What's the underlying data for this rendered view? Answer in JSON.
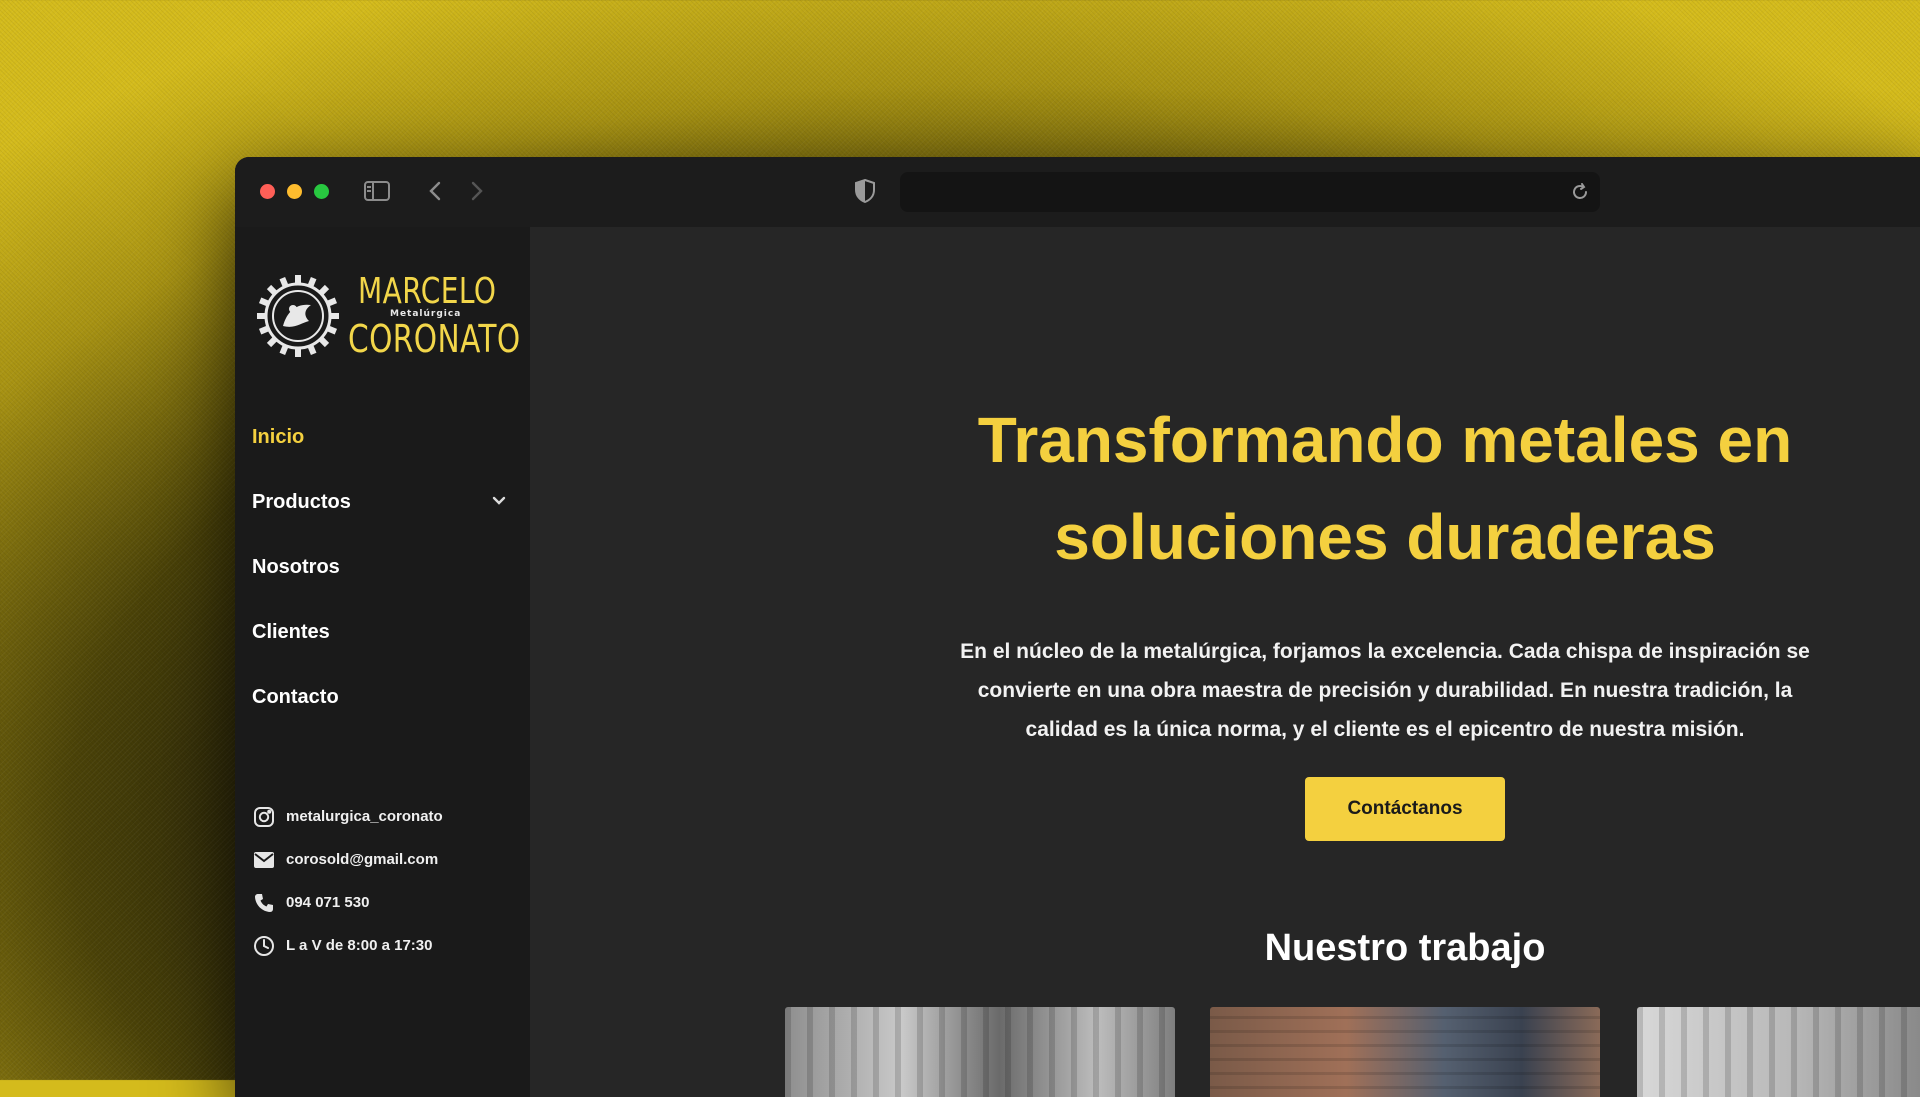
{
  "brand": {
    "name_line1": "MARCELO",
    "name_sub": "Metalúrgica",
    "name_line2": "CORONATO",
    "accent_color": "#f4d03f"
  },
  "nav": {
    "items": [
      {
        "label": "Inicio",
        "active": true
      },
      {
        "label": "Productos",
        "has_dropdown": true
      },
      {
        "label": "Nosotros"
      },
      {
        "label": "Clientes"
      },
      {
        "label": "Contacto"
      }
    ]
  },
  "contacts": [
    {
      "icon": "instagram-icon",
      "text": "metalurgica_coronato"
    },
    {
      "icon": "mail-icon",
      "text": "corosold@gmail.com"
    },
    {
      "icon": "phone-icon",
      "text": "094 071 530"
    },
    {
      "icon": "clock-icon",
      "text": "L a V de 8:00 a 17:30"
    }
  ],
  "hero": {
    "title": "Transformando metales en soluciones duraderas",
    "body": "En el núcleo de la metalúrgica, forjamos la excelencia. Cada chispa de inspiración se convierte en una obra maestra de precisión y durabilidad. En nuestra tradición, la calidad es la única norma, y el cliente es el epicentro de nuestra misión.",
    "cta_label": "Contáctanos"
  },
  "work": {
    "title": "Nuestro trabajo"
  }
}
